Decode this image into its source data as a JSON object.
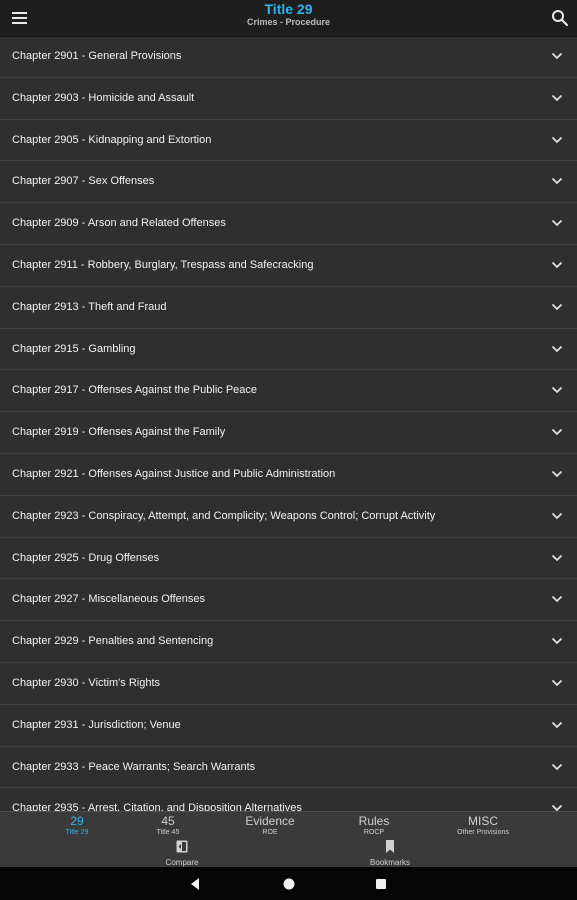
{
  "header": {
    "title": "Title 29",
    "subtitle": "Crimes - Procedure",
    "accent_color": "#2fb4f0",
    "menu_icon": "hamburger-menu-icon",
    "search_icon": "search-icon"
  },
  "chapters": [
    "Chapter 2901 - General Provisions",
    "Chapter 2903 - Homicide and Assault",
    "Chapter 2905 - Kidnapping and Extortion",
    "Chapter 2907 - Sex Offenses",
    "Chapter 2909 - Arson and Related Offenses",
    "Chapter 2911 - Robbery, Burglary, Trespass and Safecracking",
    "Chapter 2913 - Theft and Fraud",
    "Chapter 2915 - Gambling",
    "Chapter 2917 - Offenses Against the Public Peace",
    "Chapter 2919 - Offenses Against the Family",
    "Chapter 2921 - Offenses Against Justice and Public Administration",
    "Chapter 2923 - Conspiracy, Attempt, and Complicity; Weapons Control; Corrupt Activity",
    "Chapter 2925 - Drug Offenses",
    "Chapter 2927 - Miscellaneous Offenses",
    "Chapter 2929 - Penalties and Sentencing",
    "Chapter 2930 - Victim's Rights",
    "Chapter 2931 - Jurisdiction; Venue",
    "Chapter 2933 - Peace Warrants; Search Warrants",
    "Chapter 2935 - Arrest, Citation, and Disposition Alternatives"
  ],
  "bottom_nav": {
    "tabs": [
      {
        "main": "29",
        "sub": "Title 29",
        "active": true
      },
      {
        "main": "45",
        "sub": "Title 45",
        "active": false
      },
      {
        "main": "Evidence",
        "sub": "ROE",
        "active": false
      },
      {
        "main": "Rules",
        "sub": "ROCP",
        "active": false
      },
      {
        "main": "MISC",
        "sub": "Other Provisions",
        "active": false
      }
    ],
    "actions": [
      {
        "label": "Compare",
        "icon": "compare-icon"
      },
      {
        "label": "Bookmarks",
        "icon": "bookmark-icon"
      }
    ]
  },
  "system_nav": {
    "buttons": [
      "back-icon",
      "home-icon",
      "recents-icon"
    ]
  }
}
